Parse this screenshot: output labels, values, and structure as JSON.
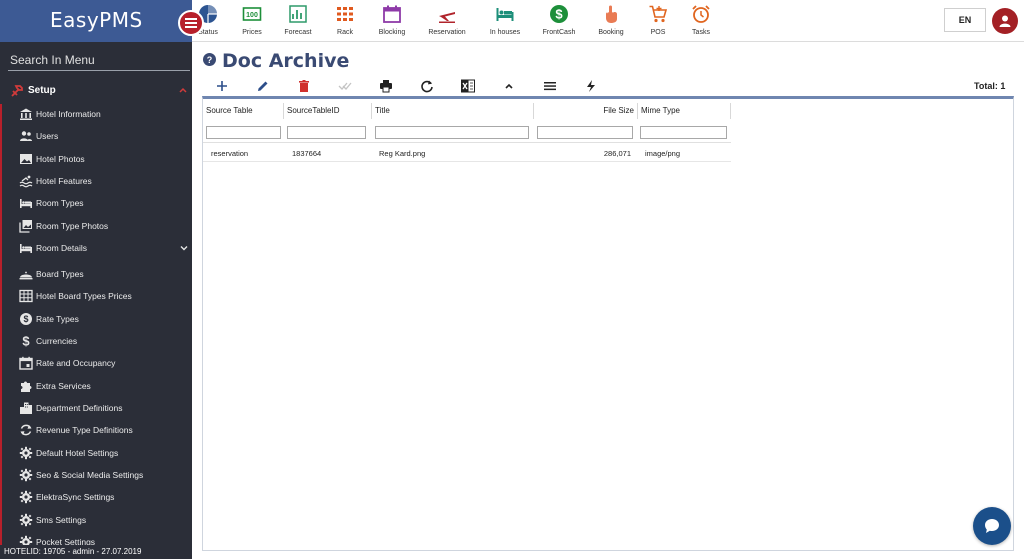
{
  "app": {
    "title": "EasyPMS"
  },
  "sidebar": {
    "search_label": "Search In Menu",
    "section": "Setup",
    "items": [
      {
        "label": "Hotel Information",
        "icon": "bank-icon"
      },
      {
        "label": "Users",
        "icon": "users-icon"
      },
      {
        "label": "Hotel Photos",
        "icon": "photo-icon"
      },
      {
        "label": "Hotel Features",
        "icon": "pool-icon"
      },
      {
        "label": "Room Types",
        "icon": "bed-icon"
      },
      {
        "label": "Room Type Photos",
        "icon": "photo-library-icon"
      },
      {
        "label": "Room Details",
        "icon": "bed-icon",
        "expandable": true
      },
      {
        "label": "Board Types",
        "icon": "room-service-icon"
      },
      {
        "label": "Hotel Board Types Prices",
        "icon": "table-grid-icon"
      },
      {
        "label": "Rate Types",
        "icon": "dollar-circle-icon"
      },
      {
        "label": "Currencies",
        "icon": "dollar-icon"
      },
      {
        "label": "Rate and Occupancy",
        "icon": "calendar-icon"
      },
      {
        "label": "Extra Services",
        "icon": "puzzle-icon"
      },
      {
        "label": "Department Definitions",
        "icon": "building-icon"
      },
      {
        "label": "Revenue Type Definitions",
        "icon": "refresh-icon"
      },
      {
        "label": "Default Hotel Settings",
        "icon": "gear-icon"
      },
      {
        "label": "Seo & Social Media Settings",
        "icon": "gear-icon"
      },
      {
        "label": "ElektraSync Settings",
        "icon": "gear-icon"
      },
      {
        "label": "Sms Settings",
        "icon": "gear-icon"
      },
      {
        "label": "Pocket Settings",
        "icon": "gear-icon"
      }
    ],
    "status": "HOTELID: 19705 - admin - 27.07.2019"
  },
  "topnav": {
    "items": [
      {
        "label": "Status",
        "icon": "pie-chart-icon",
        "color": "#2c5491"
      },
      {
        "label": "Prices",
        "icon": "price-tag-icon",
        "color": "#1d8f3a"
      },
      {
        "label": "Forecast",
        "icon": "chart-icon",
        "color": "#2e9a6a"
      },
      {
        "label": "Rack",
        "icon": "grid-icon",
        "color": "#e05a1f"
      },
      {
        "label": "Blocking",
        "icon": "calendar-icon",
        "color": "#8e3aa8"
      },
      {
        "label": "Reservation",
        "icon": "plane-icon",
        "color": "#b0242c"
      },
      {
        "label": "In houses",
        "icon": "bed-icon",
        "color": "#1d8f7a"
      },
      {
        "label": "FrontCash",
        "icon": "dollar-circle-icon",
        "color": "#1d8f3a"
      },
      {
        "label": "Booking",
        "icon": "hand-icon",
        "color": "#e97b54"
      },
      {
        "label": "POS",
        "icon": "cart-icon",
        "color": "#e0651f"
      },
      {
        "label": "Tasks",
        "icon": "alarm-icon",
        "color": "#e0651f"
      }
    ],
    "lang": "EN"
  },
  "page": {
    "title": "Doc Archive",
    "total": "Total: 1"
  },
  "grid": {
    "columns": [
      "Source Table",
      "SourceTableID",
      "Title",
      "File Size",
      "Mime Type"
    ],
    "rows": [
      {
        "source_table": "reservation",
        "source_table_id": "1837664",
        "title": "Reg Kard.png",
        "file_size": "286,071",
        "mime_type": "image/png"
      }
    ]
  },
  "colors": {
    "brand": "#3d5a94",
    "sidebar_bg": "#2b2e38",
    "accent_red": "#b7202b",
    "title": "#3a4a73"
  }
}
